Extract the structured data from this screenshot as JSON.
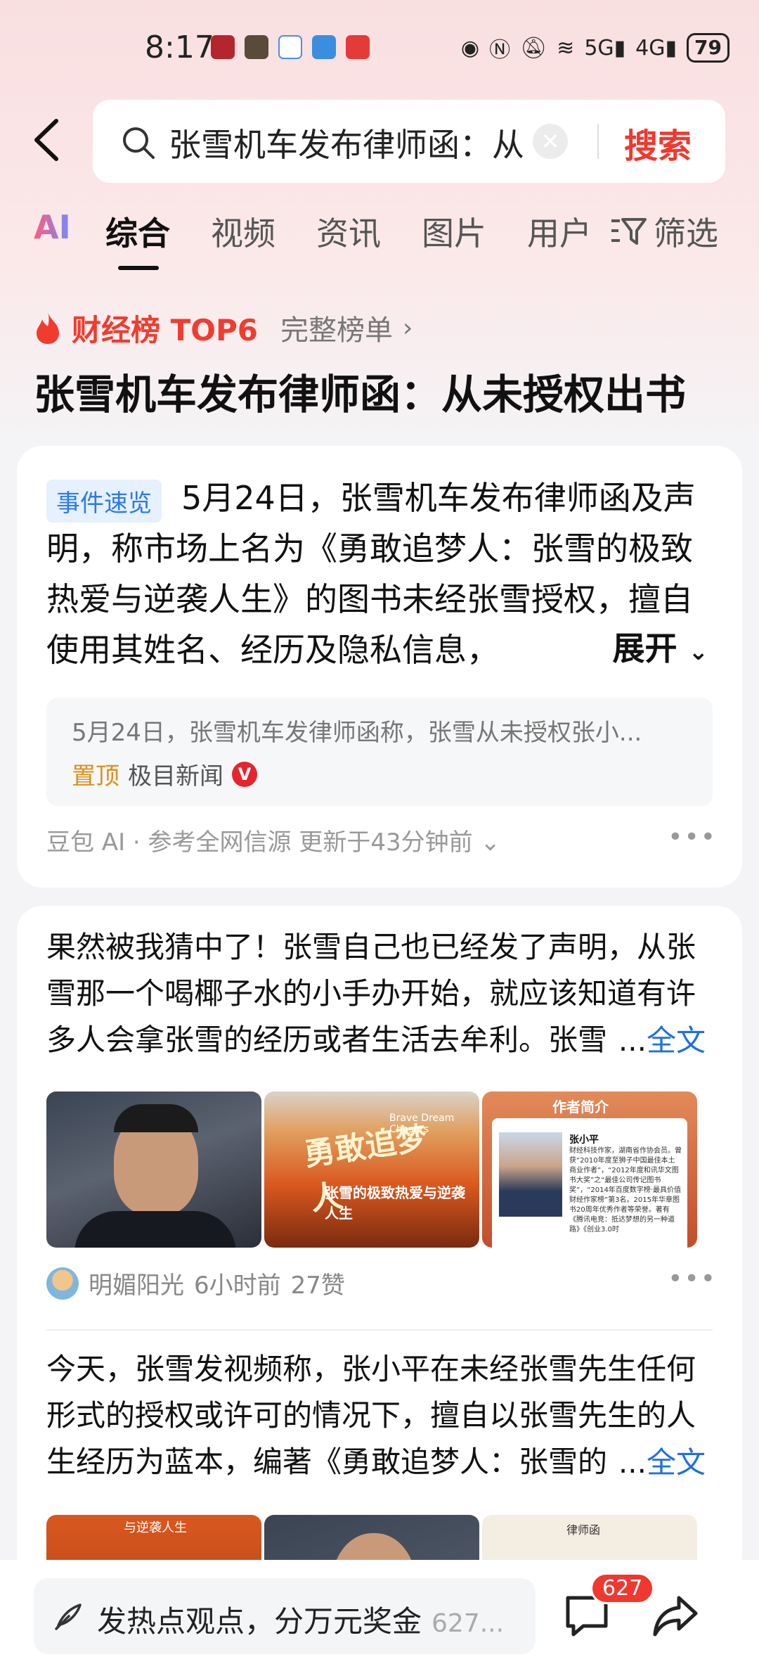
{
  "status_bar": {
    "time": "8:17",
    "battery": "79",
    "net1": "5G",
    "net2": "4G"
  },
  "search": {
    "query": "张雪机车发布律师函：从",
    "button": "搜索"
  },
  "tabs": {
    "ai": "AI",
    "items": [
      "综合",
      "视频",
      "资讯",
      "图片",
      "用户"
    ],
    "filter": "筛选"
  },
  "rank": {
    "title": "财经榜 TOP6",
    "full_list": "完整榜单",
    "headline": "张雪机车发布律师函：从未授权出书"
  },
  "event_card": {
    "tag": "事件速览",
    "text": "5月24日，张雪机车发布律师函及声明，称市场上名为《勇敢追梦人：张雪的极致热爱与逆袭人生》的图书未经张雪授权，擅自使用其姓名、经历及隐私信息，",
    "expand": "展开",
    "quote": "5月24日，张雪机车发律师函称，张雪从未授权张小...",
    "pin": "置顶",
    "source": "极目新闻",
    "meta": "豆包 AI · 参考全网信源 更新于43分钟前"
  },
  "posts": [
    {
      "text": "果然被我猜中了！张雪自己也已经发了声明，从张雪那一个喝椰子水的小手办开始，就应该知道有许多人会拿张雪的经历或者生活去牟利。张雪",
      "ellipsis": "...",
      "full": "全文",
      "book_title": "勇敢追梦人",
      "book_en": "Brave Dream Chasers",
      "book_sub": "张雪的极致热爱与逆袭人生",
      "intro_title": "作者简介",
      "intro_name": "张小平",
      "intro_body": "财经科技作家，湖南省作协会员。曾获“2010年度至狮子中国最佳本土商业作者”，“2012年度和讯华文图书大奖”之“最佳公司传记图书奖”，“2014年百度数字榜·最具价值财经作家榜”第3名。2015年华章图书20周年优秀作者等荣誉。著有《腾讯电竞：抵达梦想的另一种道路》《创业3.0时",
      "author": "明媚阳光",
      "time": "6小时前",
      "likes": "27赞"
    },
    {
      "text": "今天，张雪发视频称，张小平在未经张雪先生任何形式的授权或许可的情况下，擅自以张雪先生的人生经历为蓝本，编著《勇敢追梦人：张雪的",
      "ellipsis": "...",
      "full": "全文",
      "thumb1_caption": "与逆袭人生",
      "thumb3_caption": "律师函"
    }
  ],
  "bottom": {
    "comment_prompt": "发热点观点，分万元奖金",
    "comment_count_inline": "627...",
    "badge": "627"
  }
}
